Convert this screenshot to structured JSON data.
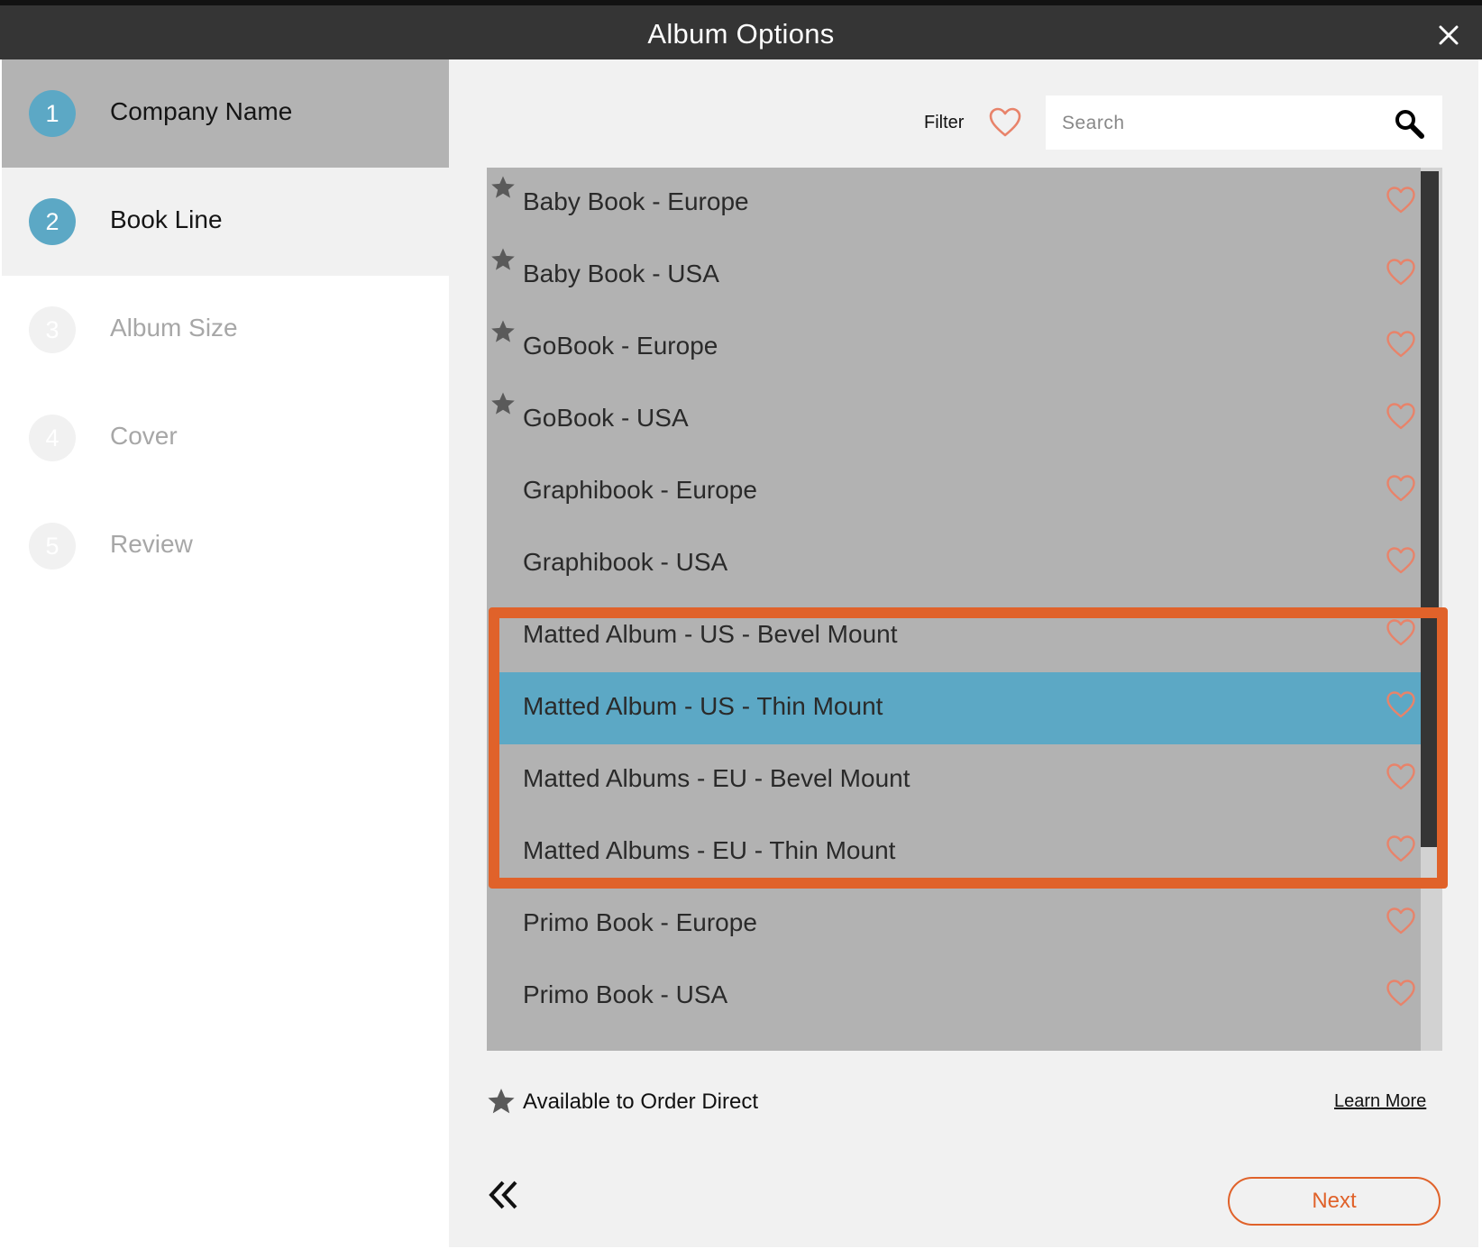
{
  "dialog": {
    "title": "Album Options"
  },
  "steps": [
    {
      "number": "1",
      "label": "Company Name",
      "state": "done"
    },
    {
      "number": "2",
      "label": "Book Line",
      "state": "active"
    },
    {
      "number": "3",
      "label": "Album Size",
      "state": "future"
    },
    {
      "number": "4",
      "label": "Cover",
      "state": "future"
    },
    {
      "number": "5",
      "label": "Review",
      "state": "future"
    }
  ],
  "toolbar": {
    "filter_label": "Filter",
    "search_placeholder": "Search"
  },
  "book_lines": [
    {
      "name": "Baby Book - Europe",
      "order_direct": true,
      "selected": false
    },
    {
      "name": "Baby Book - USA",
      "order_direct": true,
      "selected": false
    },
    {
      "name": "GoBook - Europe",
      "order_direct": true,
      "selected": false
    },
    {
      "name": "GoBook - USA",
      "order_direct": true,
      "selected": false
    },
    {
      "name": "Graphibook - Europe",
      "order_direct": false,
      "selected": false
    },
    {
      "name": "Graphibook - USA",
      "order_direct": false,
      "selected": false
    },
    {
      "name": "Matted Album - US - Bevel Mount",
      "order_direct": false,
      "selected": false
    },
    {
      "name": "Matted Album - US - Thin Mount",
      "order_direct": false,
      "selected": true
    },
    {
      "name": "Matted Albums - EU - Bevel Mount",
      "order_direct": false,
      "selected": false
    },
    {
      "name": "Matted Albums - EU - Thin Mount",
      "order_direct": false,
      "selected": false
    },
    {
      "name": "Primo Book - Europe",
      "order_direct": false,
      "selected": false
    },
    {
      "name": "Primo Book - USA",
      "order_direct": false,
      "selected": false
    }
  ],
  "legend": {
    "text": "Available to Order Direct"
  },
  "footer": {
    "learn_more": "Learn More",
    "next": "Next"
  },
  "colors": {
    "accent": "#e0622a",
    "selected": "#5ca8c5",
    "titlebar": "#353535",
    "list_bg": "#b2b2b2"
  },
  "icons": {
    "close": "close-icon",
    "filter": "heart-icon",
    "search": "search-icon",
    "order_direct": "star-icon",
    "favorite": "heart-icon",
    "back": "double-chevron-left-icon"
  }
}
